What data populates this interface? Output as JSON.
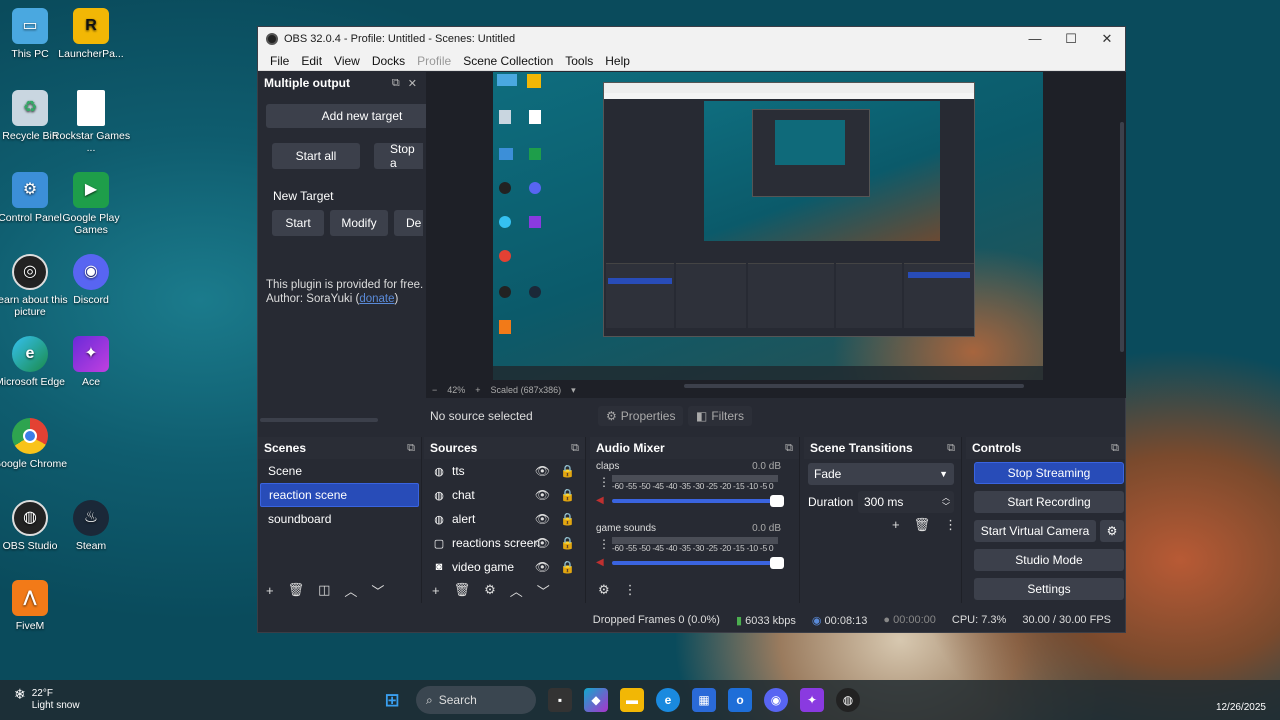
{
  "desktop": {
    "icons": [
      {
        "label": "This PC"
      },
      {
        "label": "LauncherPa..."
      },
      {
        "label": "Recycle Bin"
      },
      {
        "label": "Rockstar Games ..."
      },
      {
        "label": "Control Panel"
      },
      {
        "label": "Google Play Games"
      },
      {
        "label": "Learn about this picture"
      },
      {
        "label": "Discord"
      },
      {
        "label": "Microsoft Edge"
      },
      {
        "label": "Ace"
      },
      {
        "label": "Google Chrome"
      },
      {
        "label": "OBS Studio"
      },
      {
        "label": "Steam"
      },
      {
        "label": "FiveM"
      }
    ]
  },
  "window": {
    "title": "OBS 32.0.4 - Profile: Untitled - Scenes: Untitled",
    "controls": {
      "minimize": "—",
      "maximize": "☐",
      "close": "✕"
    }
  },
  "menu": [
    "File",
    "Edit",
    "View",
    "Docks",
    "Profile",
    "Scene Collection",
    "Tools",
    "Help"
  ],
  "multiple_output": {
    "title": "Multiple output",
    "add_target": "Add new target",
    "start_all": "Start all",
    "stop_all": "Stop a",
    "new_target": "New Target",
    "start": "Start",
    "modify": "Modify",
    "delete": "De",
    "plugin_text": "This plugin is provided for free.",
    "author_prefix": "Author: SoraYuki (",
    "donate": "donate",
    "author_suffix": ")"
  },
  "preview": {
    "zoom": "42%",
    "scale": "Scaled (687x386)",
    "minus": "−",
    "plus": "+"
  },
  "infobar": {
    "no_source": "No source selected",
    "properties": "Properties",
    "filters": "Filters"
  },
  "scenes": {
    "title": "Scenes",
    "items": [
      "Scene",
      "reaction scene",
      "soundboard"
    ],
    "selected": "reaction scene"
  },
  "sources": {
    "title": "Sources",
    "items": [
      {
        "name": "tts",
        "icon": "globe-icon"
      },
      {
        "name": "chat",
        "icon": "globe-icon"
      },
      {
        "name": "alert",
        "icon": "globe-icon"
      },
      {
        "name": "reactions screen",
        "icon": "window-icon"
      },
      {
        "name": "video game",
        "icon": "camera-icon"
      }
    ]
  },
  "audio_mixer": {
    "title": "Audio Mixer",
    "channels": [
      {
        "name": "claps",
        "db": "0.0 dB",
        "volume": 1.0
      },
      {
        "name": "game sounds",
        "db": "0.0 dB",
        "volume": 1.0
      }
    ],
    "scale": "-60 -55 -50 -45 -40 -35 -30 -25 -20 -15 -10 -5 0"
  },
  "scene_transitions": {
    "title": "Scene Transitions",
    "transition": "Fade",
    "duration_label": "Duration",
    "duration_value": "300 ms"
  },
  "controls": {
    "title": "Controls",
    "stop_streaming": "Stop Streaming",
    "start_recording": "Start Recording",
    "start_virtual_camera": "Start Virtual Camera",
    "studio_mode": "Studio Mode",
    "settings": "Settings"
  },
  "status": {
    "dropped_frames": "Dropped Frames 0 (0.0%)",
    "bitrate": "6033 kbps",
    "stream_time": "00:08:13",
    "rec_time": "00:00:00",
    "cpu": "CPU: 7.3%",
    "fps": "30.00 / 30.00 FPS"
  },
  "taskbar": {
    "temp": "22°F",
    "weather": "Light snow",
    "search": "Search",
    "date": "12/26/2025"
  },
  "colors": {
    "accent": "#284cb8",
    "window_bg": "#272a33",
    "dock_header": "#2a2d36"
  }
}
